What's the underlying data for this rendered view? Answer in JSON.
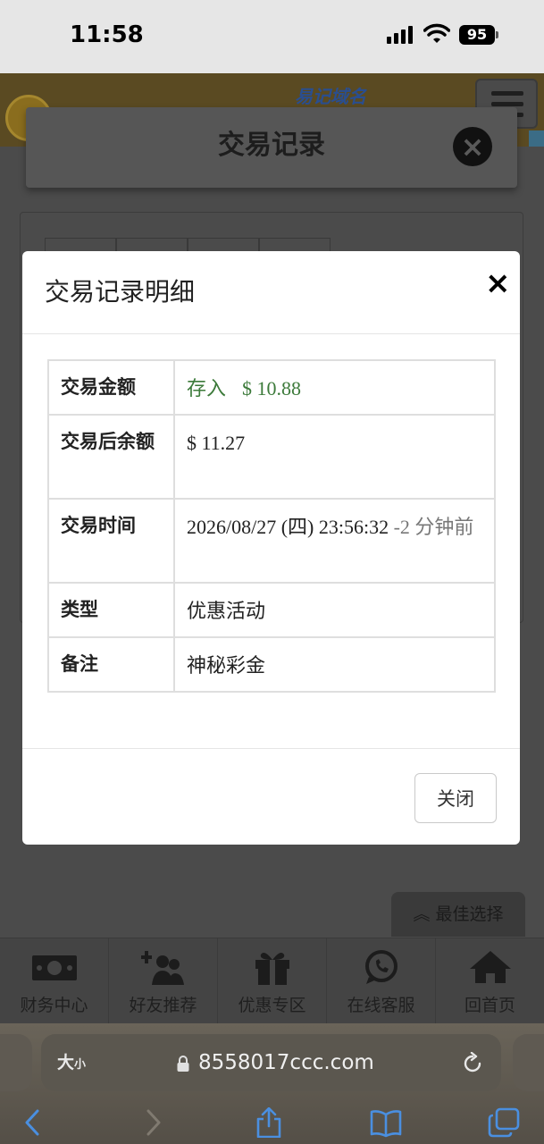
{
  "status_bar": {
    "time": "11:58",
    "battery": "95",
    "icons": [
      "signal-icon",
      "wifi-icon",
      "battery-icon"
    ]
  },
  "site": {
    "domain_hint": "易记域名",
    "panel_title": "交易记录",
    "best_choice": "最佳选择",
    "nav": [
      {
        "label": "财务中心",
        "icon": "money-icon"
      },
      {
        "label": "好友推荐",
        "icon": "add-friend-icon"
      },
      {
        "label": "优惠专区",
        "icon": "gift-icon"
      },
      {
        "label": "在线客服",
        "icon": "whatsapp-icon"
      },
      {
        "label": "回首页",
        "icon": "home-icon"
      }
    ]
  },
  "modal": {
    "title": "交易记录明细",
    "close_glyph": "×",
    "rows": {
      "amount": {
        "label": "交易金额",
        "type": "存入",
        "value": "$ 10.88"
      },
      "balance": {
        "label": "交易后余额",
        "value": "$ 11.27"
      },
      "time": {
        "label": "交易时间",
        "value": "2026/08/27 (四) 23:56:32",
        "relative": "-2 分钟前"
      },
      "category": {
        "label": "类型",
        "value": "优惠活动"
      },
      "note": {
        "label": "备注",
        "value": "神秘彩金"
      }
    },
    "close_button": "关闭"
  },
  "browser": {
    "text_size_label": "大",
    "text_size_small": "小",
    "url": "8558017ccc.com"
  },
  "colors": {
    "deposit_green": "#3c7a3a",
    "relative_gray": "#777777",
    "overlay": "#4b4b4b"
  }
}
